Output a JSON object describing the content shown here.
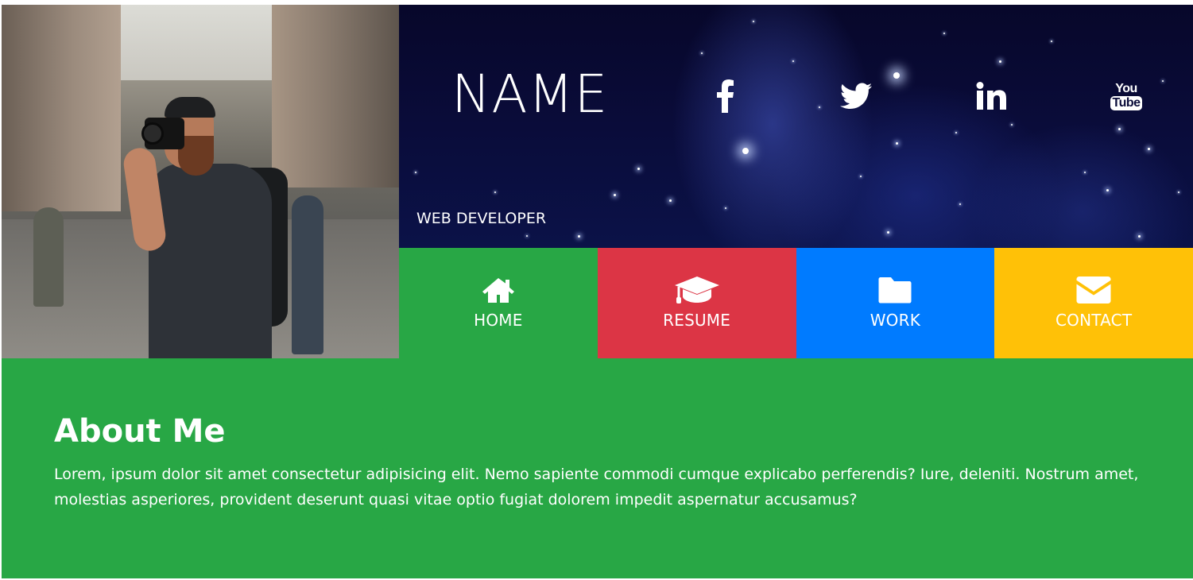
{
  "header": {
    "name": "NAME",
    "tagline": "WEB DEVELOPER",
    "social": [
      {
        "icon": "facebook-icon"
      },
      {
        "icon": "twitter-icon"
      },
      {
        "icon": "linkedin-icon"
      },
      {
        "icon": "youtube-icon",
        "text": "You",
        "text2": "Tube"
      }
    ]
  },
  "nav": {
    "items": [
      {
        "label": "HOME",
        "icon": "home-icon",
        "color": "#28a745"
      },
      {
        "label": "RESUME",
        "icon": "graduation-cap-icon",
        "color": "#dc3545"
      },
      {
        "label": "WORK",
        "icon": "folder-icon",
        "color": "#007bff"
      },
      {
        "label": "CONTACT",
        "icon": "envelope-icon",
        "color": "#ffc107"
      }
    ]
  },
  "about": {
    "title": "About Me",
    "body": "Lorem, ipsum dolor sit amet consectetur adipisicing elit. Nemo sapiente commodi cumque explicabo perferendis? Iure, deleniti. Nostrum amet, molestias asperiores, provident deserunt quasi vitae optio fugiat dolorem impedit aspernatur accusamus?",
    "background": "#28a745"
  }
}
